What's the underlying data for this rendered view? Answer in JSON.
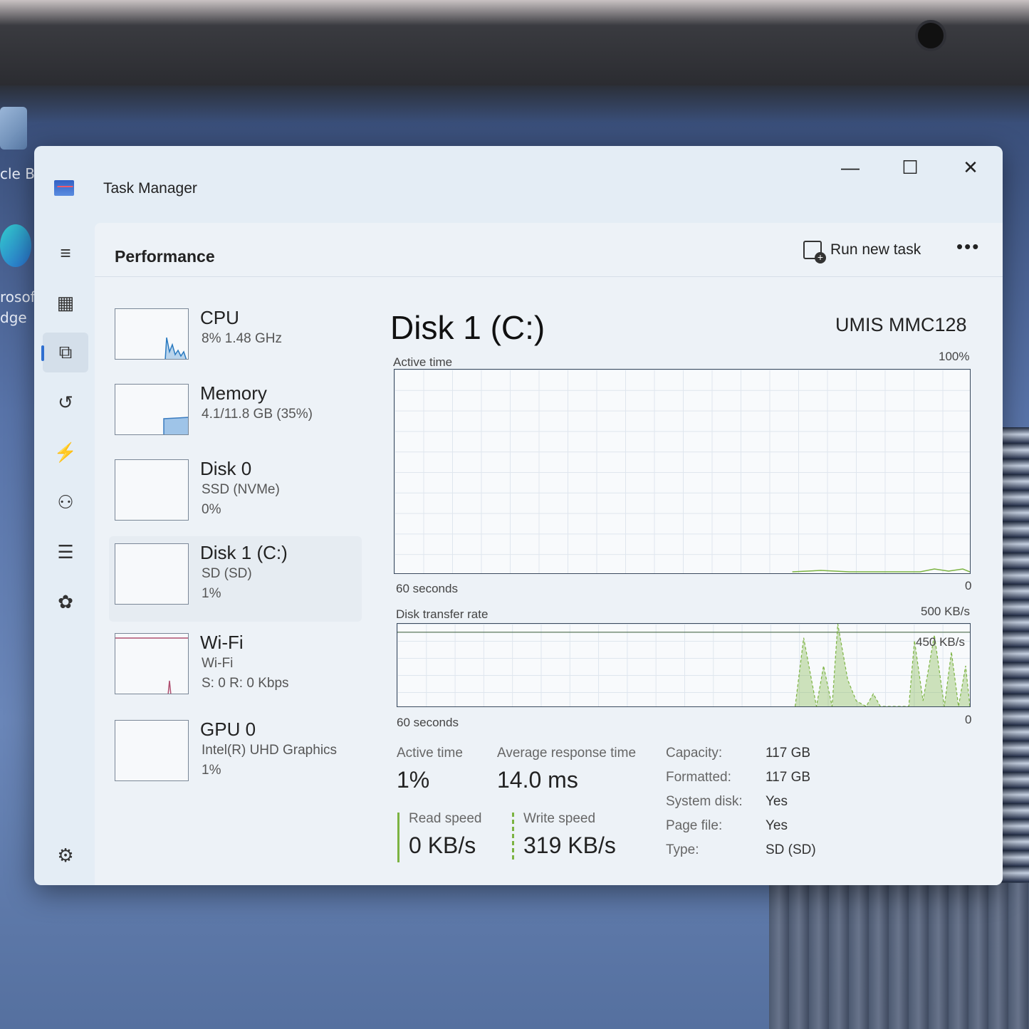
{
  "window": {
    "title": "Task Manager"
  },
  "desktop": {
    "label_1": "cle B",
    "label_2": "rosof",
    "label_3": "dge"
  },
  "header": {
    "page_title": "Performance",
    "run_new_task": "Run new task",
    "more": "•••"
  },
  "nav": {
    "items": [
      {
        "name": "hamburger-menu-icon",
        "glyph": "≡"
      },
      {
        "name": "processes-icon",
        "glyph": "▦"
      },
      {
        "name": "performance-icon",
        "glyph": "⧉"
      },
      {
        "name": "app-history-icon",
        "glyph": "↺"
      },
      {
        "name": "startup-apps-icon",
        "glyph": "⚡"
      },
      {
        "name": "users-icon",
        "glyph": "👥"
      },
      {
        "name": "details-icon",
        "glyph": "☰"
      },
      {
        "name": "services-icon",
        "glyph": "⚙"
      }
    ],
    "settings_glyph": "⚙"
  },
  "devices": [
    {
      "name": "CPU",
      "sub1": "8%  1.48 GHz",
      "sub2": "",
      "sub3": ""
    },
    {
      "name": "Memory",
      "sub1": "4.1/11.8 GB (35%)",
      "sub2": "",
      "sub3": ""
    },
    {
      "name": "Disk 0",
      "sub1": "SSD (NVMe)",
      "sub2": "0%",
      "sub3": ""
    },
    {
      "name": "Disk 1 (C:)",
      "sub1": "SD (SD)",
      "sub2": "1%",
      "sub3": ""
    },
    {
      "name": "Wi-Fi",
      "sub1": "Wi-Fi",
      "sub2": "S: 0 R: 0 Kbps",
      "sub3": ""
    },
    {
      "name": "GPU 0",
      "sub1": "Intel(R) UHD Graphics",
      "sub2": "1%",
      "sub3": ""
    }
  ],
  "detail": {
    "title": "Disk 1 (C:)",
    "model": "UMIS MMC128",
    "active_time_label": "Active time",
    "active_time_max": "100%",
    "active_time_seconds": "60 seconds",
    "active_time_min": "0",
    "transfer_label": "Disk transfer rate",
    "transfer_max": "500 KB/s",
    "transfer_mid": "450 KB/s",
    "transfer_seconds": "60 seconds",
    "transfer_min": "0",
    "stats": {
      "active_time_label": "Active time",
      "active_time_value": "1%",
      "avg_response_label": "Average response time",
      "avg_response_value": "14.0 ms",
      "read_speed_label": "Read speed",
      "read_speed_value": "0 KB/s",
      "write_speed_label": "Write speed",
      "write_speed_value": "319 KB/s"
    },
    "props": [
      {
        "key": "Capacity:",
        "value": "117 GB"
      },
      {
        "key": "Formatted:",
        "value": "117 GB"
      },
      {
        "key": "System disk:",
        "value": "Yes"
      },
      {
        "key": "Page file:",
        "value": "Yes"
      },
      {
        "key": "Type:",
        "value": "SD (SD)"
      }
    ]
  },
  "colors": {
    "accent": "#2f6fd0",
    "read": "#7cb342",
    "write": "#7cb342",
    "wifi": "#b05070",
    "cpu": "#2a7ac0"
  }
}
